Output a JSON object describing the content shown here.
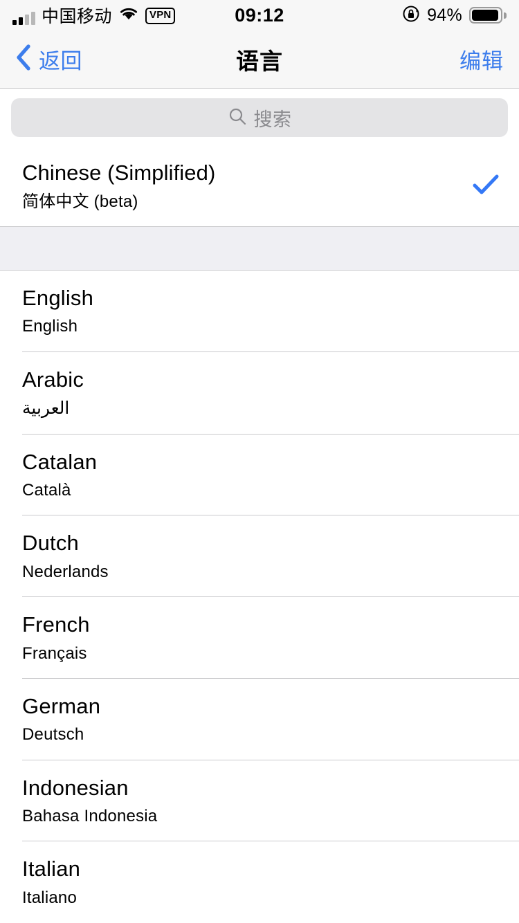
{
  "status_bar": {
    "carrier": "中国移动",
    "signal_icon": "signal-bars-icon",
    "signal_bars_filled": 2,
    "signal_bars_total": 4,
    "wifi_icon": "wifi-icon",
    "vpn_badge": "VPN",
    "time": "09:12",
    "rotation_lock_icon": "rotation-lock-icon",
    "battery_percent": "94%",
    "battery_level": 94,
    "battery_icon": "battery-icon"
  },
  "nav_bar": {
    "back_icon": "chevron-left-icon",
    "back_label": "返回",
    "title": "语言",
    "edit_label": "编辑"
  },
  "search": {
    "icon": "search-icon",
    "placeholder": "搜索",
    "value": ""
  },
  "selected_section": [
    {
      "name": "Chinese (Simplified)",
      "native": "简体中文 (beta)",
      "selected": true,
      "check_icon": "checkmark-icon"
    }
  ],
  "available_section": [
    {
      "name": "English",
      "native": "English",
      "selected": false
    },
    {
      "name": "Arabic",
      "native": "العربية",
      "selected": false,
      "rtl": true
    },
    {
      "name": "Catalan",
      "native": "Català",
      "selected": false
    },
    {
      "name": "Dutch",
      "native": "Nederlands",
      "selected": false
    },
    {
      "name": "French",
      "native": "Français",
      "selected": false
    },
    {
      "name": "German",
      "native": "Deutsch",
      "selected": false
    },
    {
      "name": "Indonesian",
      "native": "Bahasa Indonesia",
      "selected": false
    },
    {
      "name": "Italian",
      "native": "Italiano",
      "selected": false
    }
  ],
  "colors": {
    "accent_blue": "#3C7DEC",
    "check_blue": "#3478F6",
    "bar_background": "#F7F7F7",
    "group_gap": "#EFEFF3",
    "separator": "#C9C9CC",
    "search_field": "#E4E4E6",
    "placeholder_text": "#8A8A8E"
  }
}
